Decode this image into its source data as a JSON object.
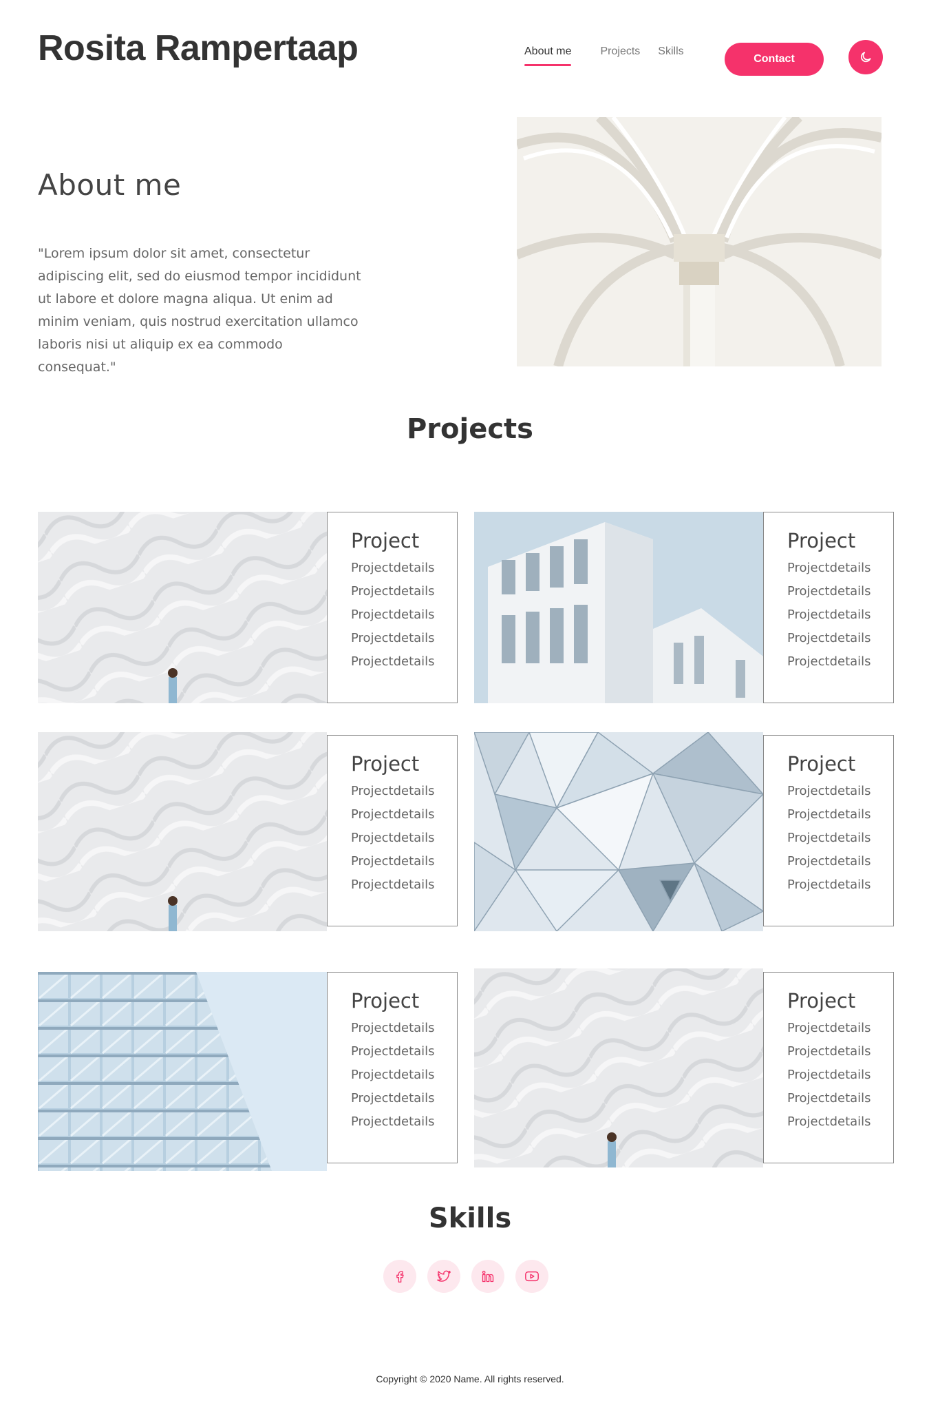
{
  "header": {
    "brand": "Rosita Rampertaap",
    "nav": [
      {
        "label": "About me",
        "active": true
      },
      {
        "label": "Projects",
        "active": false
      },
      {
        "label": "Skills",
        "active": false
      }
    ],
    "contact_label": "Contact",
    "theme_icon": "moon-icon"
  },
  "about": {
    "title": "About me",
    "text": "\"Lorem ipsum dolor sit amet, consectetur adipiscing elit, sed do eiusmod tempor incididunt ut labore et dolore magna aliqua. Ut enim ad minim veniam, quis nostrud exercitation ullamco laboris nisi ut aliquip ex ea commodo consequat.\""
  },
  "projects": {
    "title": "Projects",
    "items": [
      {
        "title": "Project",
        "details": [
          "Projectdetails",
          "Projectdetails",
          "Projectdetails",
          "Projectdetails",
          "Projectdetails"
        ]
      },
      {
        "title": "Project",
        "details": [
          "Projectdetails",
          "Projectdetails",
          "Projectdetails",
          "Projectdetails",
          "Projectdetails"
        ]
      },
      {
        "title": "Project",
        "details": [
          "Projectdetails",
          "Projectdetails",
          "Projectdetails",
          "Projectdetails",
          "Projectdetails"
        ]
      },
      {
        "title": "Project",
        "details": [
          "Projectdetails",
          "Projectdetails",
          "Projectdetails",
          "Projectdetails",
          "Projectdetails"
        ]
      },
      {
        "title": "Project",
        "details": [
          "Projectdetails",
          "Projectdetails",
          "Projectdetails",
          "Projectdetails",
          "Projectdetails"
        ]
      },
      {
        "title": "Project",
        "details": [
          "Projectdetails",
          "Projectdetails",
          "Projectdetails",
          "Projectdetails",
          "Projectdetails"
        ]
      }
    ]
  },
  "skills": {
    "title": "Skills",
    "social": [
      "facebook-icon",
      "twitter-icon",
      "linkedin-icon",
      "youtube-icon"
    ]
  },
  "footer": {
    "copyright": "Copyright © 2020 Name. All rights reserved."
  },
  "colors": {
    "accent": "#f5326b",
    "accent_soft": "#fde8ee"
  }
}
